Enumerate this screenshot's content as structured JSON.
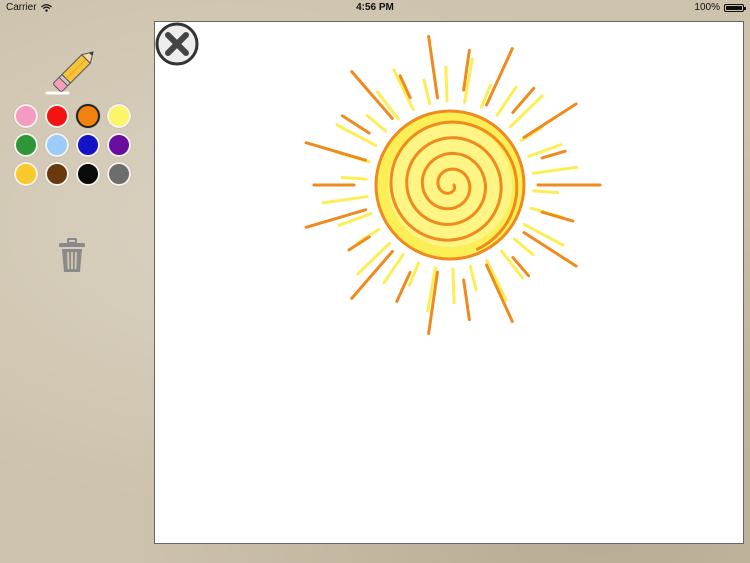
{
  "status_bar": {
    "carrier": "Carrier",
    "time": "4:56 PM",
    "battery": "100%",
    "battery_level": 1.0
  },
  "tools": {
    "pencil_icon": "pencil-icon",
    "trash_icon": "trash-icon",
    "close_icon": "close-icon"
  },
  "palette": {
    "selected_index": 2,
    "colors": [
      "#f59bc3",
      "#f31313",
      "#f2810d",
      "#fbf56a",
      "#2e9636",
      "#9bcbf6",
      "#1313c8",
      "#6a0ea0",
      "#f8c92b",
      "#6a3a0d",
      "#0a0a0a",
      "#6d6d6d"
    ]
  },
  "drawing": {
    "stroke_colors": {
      "orange": "#ef8a1e",
      "yellow": "#fcee55",
      "light_yellow": "#fff89a"
    }
  }
}
